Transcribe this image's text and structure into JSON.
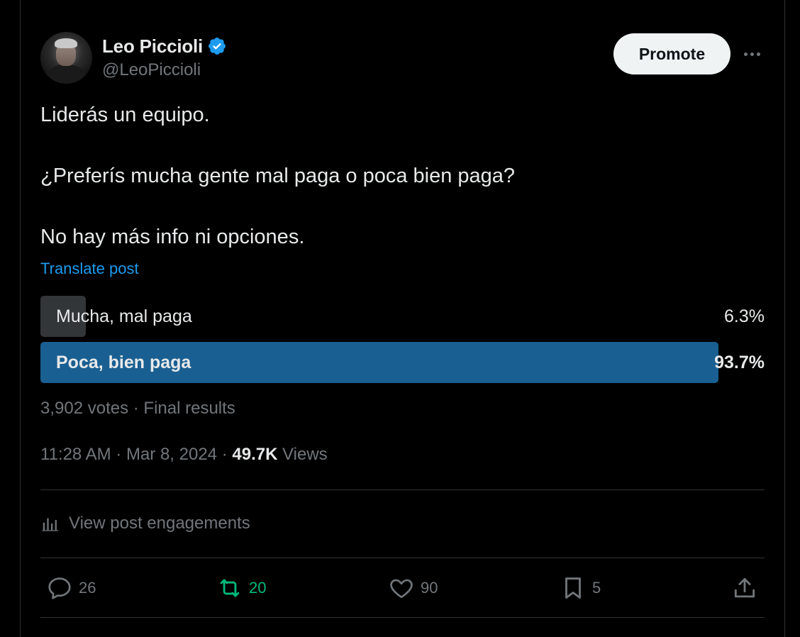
{
  "author": {
    "name": "Leo Piccioli",
    "handle": "@LeoPiccioli",
    "verified": true
  },
  "header": {
    "promote_label": "Promote",
    "more_icon": "more-horizontal-icon"
  },
  "post": {
    "lines": [
      "Liderás un equipo.",
      "¿Preferís mucha gente mal paga o poca bien paga?",
      "No hay más info ni opciones."
    ],
    "translate_label": "Translate post"
  },
  "poll": {
    "options": [
      {
        "label": "Mucha, mal paga",
        "percent_text": "6.3%",
        "percent": 6.3,
        "winner": false
      },
      {
        "label": "Poca, bien paga",
        "percent_text": "93.7%",
        "percent": 93.7,
        "winner": true
      }
    ],
    "meta": "3,902 votes · Final results"
  },
  "timestamp": {
    "time_date": "11:28 AM · Mar 8, 2024",
    "separator": "·",
    "views_count": "49.7K",
    "views_label": "Views"
  },
  "engagements": {
    "label": "View post engagements",
    "icon": "analytics-icon"
  },
  "actions": {
    "reply": {
      "icon": "reply-icon",
      "count": "26"
    },
    "retweet": {
      "icon": "retweet-icon",
      "count": "20"
    },
    "like": {
      "icon": "heart-icon",
      "count": "90"
    },
    "bookmark": {
      "icon": "bookmark-icon",
      "count": "5"
    },
    "share": {
      "icon": "share-icon"
    }
  },
  "colors": {
    "background": "#000000",
    "text": "#e7e9ea",
    "muted": "#71767b",
    "link": "#1d9bf0",
    "poll_winner": "#1a5f91",
    "poll_loser": "#333639",
    "retweet": "#00ba7c",
    "verified": "#1d9bf0"
  }
}
